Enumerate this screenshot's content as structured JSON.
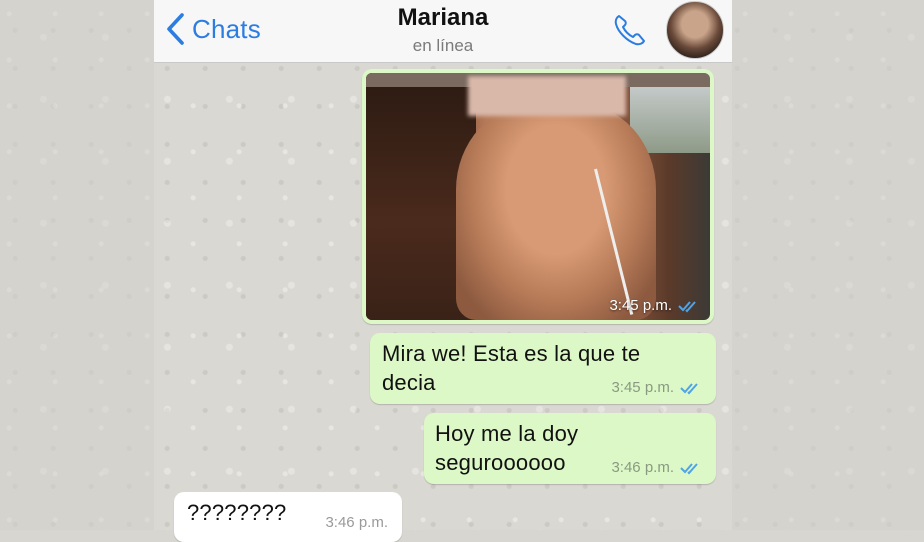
{
  "header": {
    "back_label": "Chats",
    "contact_name": "Mariana",
    "status": "en línea"
  },
  "messages": [
    {
      "type": "image",
      "direction": "outgoing",
      "time": "3:45 p.m.",
      "read": true
    },
    {
      "type": "text",
      "direction": "outgoing",
      "line1": "Mira we! Esta es la que te",
      "line2": "decia",
      "time": "3:45 p.m.",
      "read": true
    },
    {
      "type": "text",
      "direction": "outgoing",
      "line1": "Hoy me la doy",
      "line2": "seguroooooo",
      "time": "3:46 p.m.",
      "read": true
    },
    {
      "type": "text",
      "direction": "incoming",
      "line1": "????????",
      "time": "3:46 p.m."
    }
  ],
  "colors": {
    "accent": "#2b7de1",
    "outgoing_bubble": "#dcf8c6",
    "incoming_bubble": "#ffffff",
    "read_ticks": "#4fa3e8"
  },
  "icons": {
    "back": "chevron-left-icon",
    "call": "phone-icon",
    "read": "double-check-icon"
  }
}
